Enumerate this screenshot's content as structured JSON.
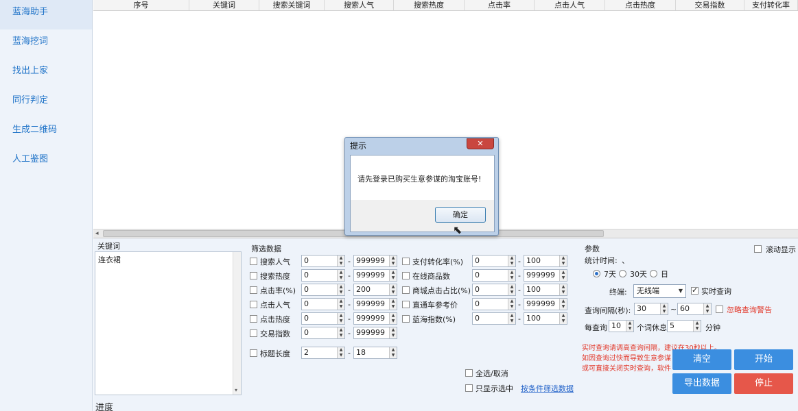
{
  "sidebar": {
    "items": [
      {
        "label": "蓝海助手"
      },
      {
        "label": "蓝海挖词"
      },
      {
        "label": "找出上家"
      },
      {
        "label": "同行判定"
      },
      {
        "label": "生成二维码"
      },
      {
        "label": "人工鉴图"
      }
    ]
  },
  "table": {
    "columns": [
      "序号",
      "关键词",
      "搜索关键词",
      "搜索人气",
      "搜索热度",
      "点击率",
      "点击人气",
      "点击热度",
      "交易指数",
      "支付转化率"
    ],
    "scroll_left_icon": "◂"
  },
  "keywords": {
    "title": "关键词",
    "value": "连衣裙",
    "scroll_down_icon": "▾"
  },
  "filter": {
    "title": "筛选数据",
    "left_rows": [
      {
        "label": "搜索人气",
        "min": "0",
        "max": "999999"
      },
      {
        "label": "搜索热度",
        "min": "0",
        "max": "999999"
      },
      {
        "label": "点击率(%)",
        "min": "0",
        "max": "200"
      },
      {
        "label": "点击人气",
        "min": "0",
        "max": "999999"
      },
      {
        "label": "点击热度",
        "min": "0",
        "max": "999999"
      },
      {
        "label": "交易指数",
        "min": "0",
        "max": "999999"
      }
    ],
    "right_rows": [
      {
        "label": "支付转化率(%)",
        "min": "0",
        "max": "100"
      },
      {
        "label": "在线商品数",
        "min": "0",
        "max": "999999"
      },
      {
        "label": "商城点击占比(%)",
        "min": "0",
        "max": "100"
      },
      {
        "label": "直通车参考价",
        "min": "0",
        "max": "999999"
      },
      {
        "label": "蓝海指数(%)",
        "min": "0",
        "max": "100"
      }
    ],
    "title_length": {
      "label": "标题长度",
      "min": "2",
      "max": "18"
    },
    "dash": "-",
    "select_all": "全选/取消",
    "only_selected": "只显示选中",
    "filter_link": "按条件筛选数据"
  },
  "params": {
    "title": "参数",
    "auto_scroll": "滚动显示",
    "stat_time_label": "统计时间:",
    "stat_time_extra": "、",
    "radios": [
      {
        "label": "7天",
        "checked": true
      },
      {
        "label": "30天",
        "checked": false
      },
      {
        "label": "日",
        "checked": false
      }
    ],
    "device_label": "终端:",
    "device_value": "无线端",
    "realtime_label": "实时查询",
    "interval_label": "查询间隔(秒):",
    "interval_min": "30",
    "interval_sep": "~",
    "interval_max": "60",
    "ignore_warning": "忽略查询警告",
    "per_query_label": "每查询",
    "per_query_value": "10",
    "rest_label": "个词休息",
    "rest_value": "5",
    "minute_label": "分钟",
    "warn_line1": "实时查询请调高查询间隔，建议在30秒以上。",
    "warn_line2": "如因查询过快而导致生意参谋",
    "warn_line3": "或可直接关闭实时查询，软件"
  },
  "actions": {
    "clear": "清空",
    "start": "开始",
    "export": "导出数据",
    "stop": "停止"
  },
  "progress_label": "进度",
  "dialog": {
    "title": "提示",
    "close_icon": "✕",
    "message": "请先登录已购买生意参谋的淘宝账号!",
    "ok": "确定"
  },
  "icons": {
    "spin_up": "▲",
    "spin_down": "▼",
    "dropdown": "▼",
    "cursor": "⬉"
  },
  "colors": {
    "accent": "#3b8ee0",
    "danger": "#e6574a",
    "warning_text": "#e2382a"
  }
}
